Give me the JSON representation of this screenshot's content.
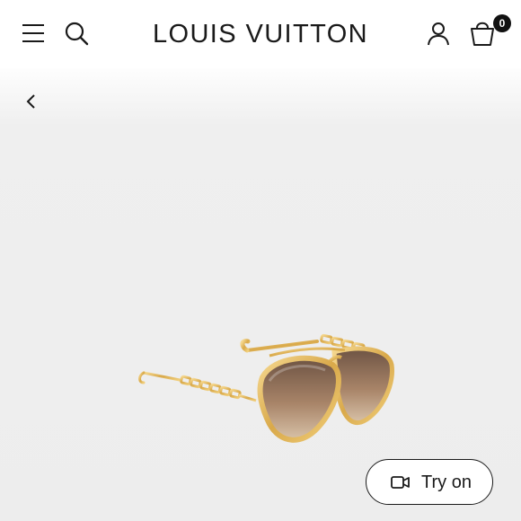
{
  "header": {
    "brand": "LOUIS VUITTON",
    "menu_icon": "hamburger-menu-icon",
    "search_icon": "search-icon",
    "account_icon": "account-icon",
    "bag_icon": "shopping-bag-icon",
    "bag_count": "0"
  },
  "navigation": {
    "back_icon": "chevron-left-icon"
  },
  "product": {
    "image": "aviator-sunglasses-gold-chain-temples"
  },
  "actions": {
    "try_on_label": "Try on",
    "try_on_icon": "video-camera-icon"
  },
  "colors": {
    "frame_gold": "#e2b95a",
    "lens_brown": "#8a6a4e",
    "background": "#ededed",
    "text": "#1a1a1a"
  }
}
